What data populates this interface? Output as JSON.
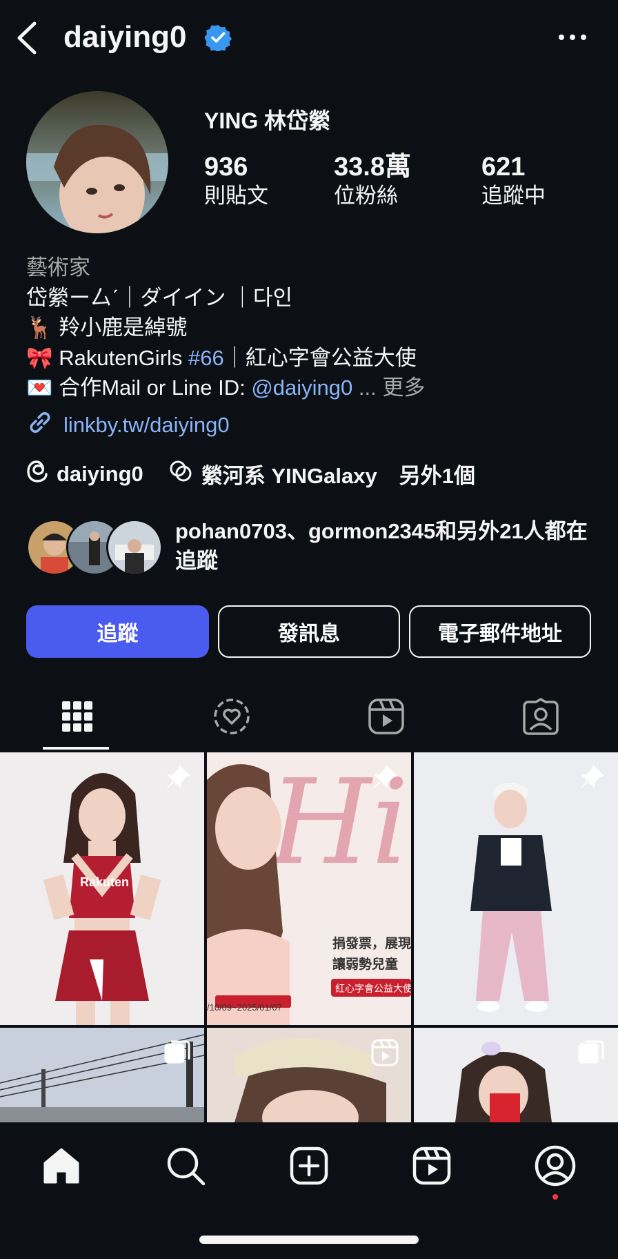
{
  "header": {
    "username": "daiying0",
    "verified": true,
    "back_icon": "chevron-left-icon",
    "more_icon": "more-horizontal-icon"
  },
  "profile": {
    "full_name": "YING 林岱縈",
    "stats": [
      {
        "value": "936",
        "label": "則貼文"
      },
      {
        "value": "33.8萬",
        "label": "位粉絲"
      },
      {
        "value": "621",
        "label": "追蹤中"
      }
    ],
    "category": "藝術家",
    "bio_lines": {
      "line1": "岱縈ー厶ˊ｜ダイイン ｜다인",
      "line2_emoji": "🦌",
      "line2_text": "羚小鹿是綽號",
      "line3_emoji": "🎀",
      "line3_a": "RakutenGirls ",
      "line3_tag": "#66",
      "line3_b": "｜紅心字會公益大使",
      "line4_emoji": "💌",
      "line4_a": "合作Mail or Line ID: ",
      "line4_mention": "@daiying0",
      "line4_ellipsis": " ... ",
      "line4_more": "更多"
    },
    "link": "linkby.tw/daiying0",
    "threads_handle": "daiying0",
    "channel": "縈河系 YINGalaxy",
    "other": "另外1個",
    "followed_by": "pohan0703、gormon2345和另外21人都在追蹤"
  },
  "buttons": {
    "follow": "追蹤",
    "message": "發訊息",
    "email": "電子郵件地址"
  },
  "colors": {
    "background": "#0c1014",
    "accent": "#4a5bef",
    "link": "#8ab4f8",
    "notification_dot": "#ff3040"
  },
  "tabs": [
    "grid-icon",
    "highlights-icon",
    "reels-icon",
    "tagged-icon"
  ],
  "grid_overlays": {
    "post2_caption1": "捐發票，展現",
    "post2_caption2": "讓弱勢兒童",
    "post2_badge": "紅心字會公益大使",
    "post2_date": "/10/09~2025/01/07",
    "post1_jersey": "Rakuten"
  },
  "bottom_nav": [
    "home-icon",
    "search-icon",
    "create-icon",
    "reels-icon",
    "profile-icon"
  ]
}
